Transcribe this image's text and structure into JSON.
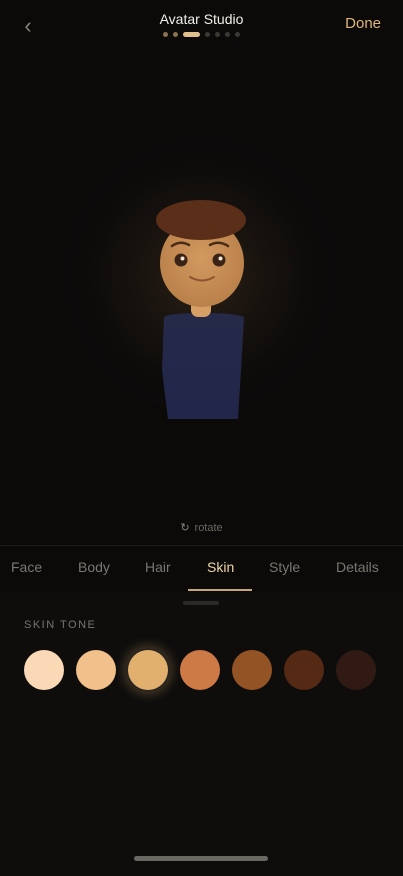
{
  "header": {
    "title": "Avatar Studio",
    "done_label": "Done",
    "back_icon": "chevron-left-icon",
    "progress": {
      "total_steps": 7,
      "current_step": 3
    }
  },
  "preview": {
    "rotate_label": "rotate",
    "rotate_icon": "rotate-icon",
    "colors": {
      "hair": "#5a2e18",
      "skin": "#c79058",
      "shirt": "#252a49"
    }
  },
  "tabs": [
    {
      "label": "Face"
    },
    {
      "label": "Body"
    },
    {
      "label": "Hair"
    },
    {
      "label": "Skin",
      "active": true
    },
    {
      "label": "Style"
    },
    {
      "label": "Details"
    }
  ],
  "panel": {
    "section_label": "SKIN TONE",
    "swatches": [
      {
        "color": "#fcd9b6"
      },
      {
        "color": "#f2c08a"
      },
      {
        "color": "#e2b06e",
        "selected": true
      },
      {
        "color": "#cd7a46"
      },
      {
        "color": "#945325"
      },
      {
        "color": "#552a14"
      },
      {
        "color": "#301a13"
      }
    ]
  }
}
